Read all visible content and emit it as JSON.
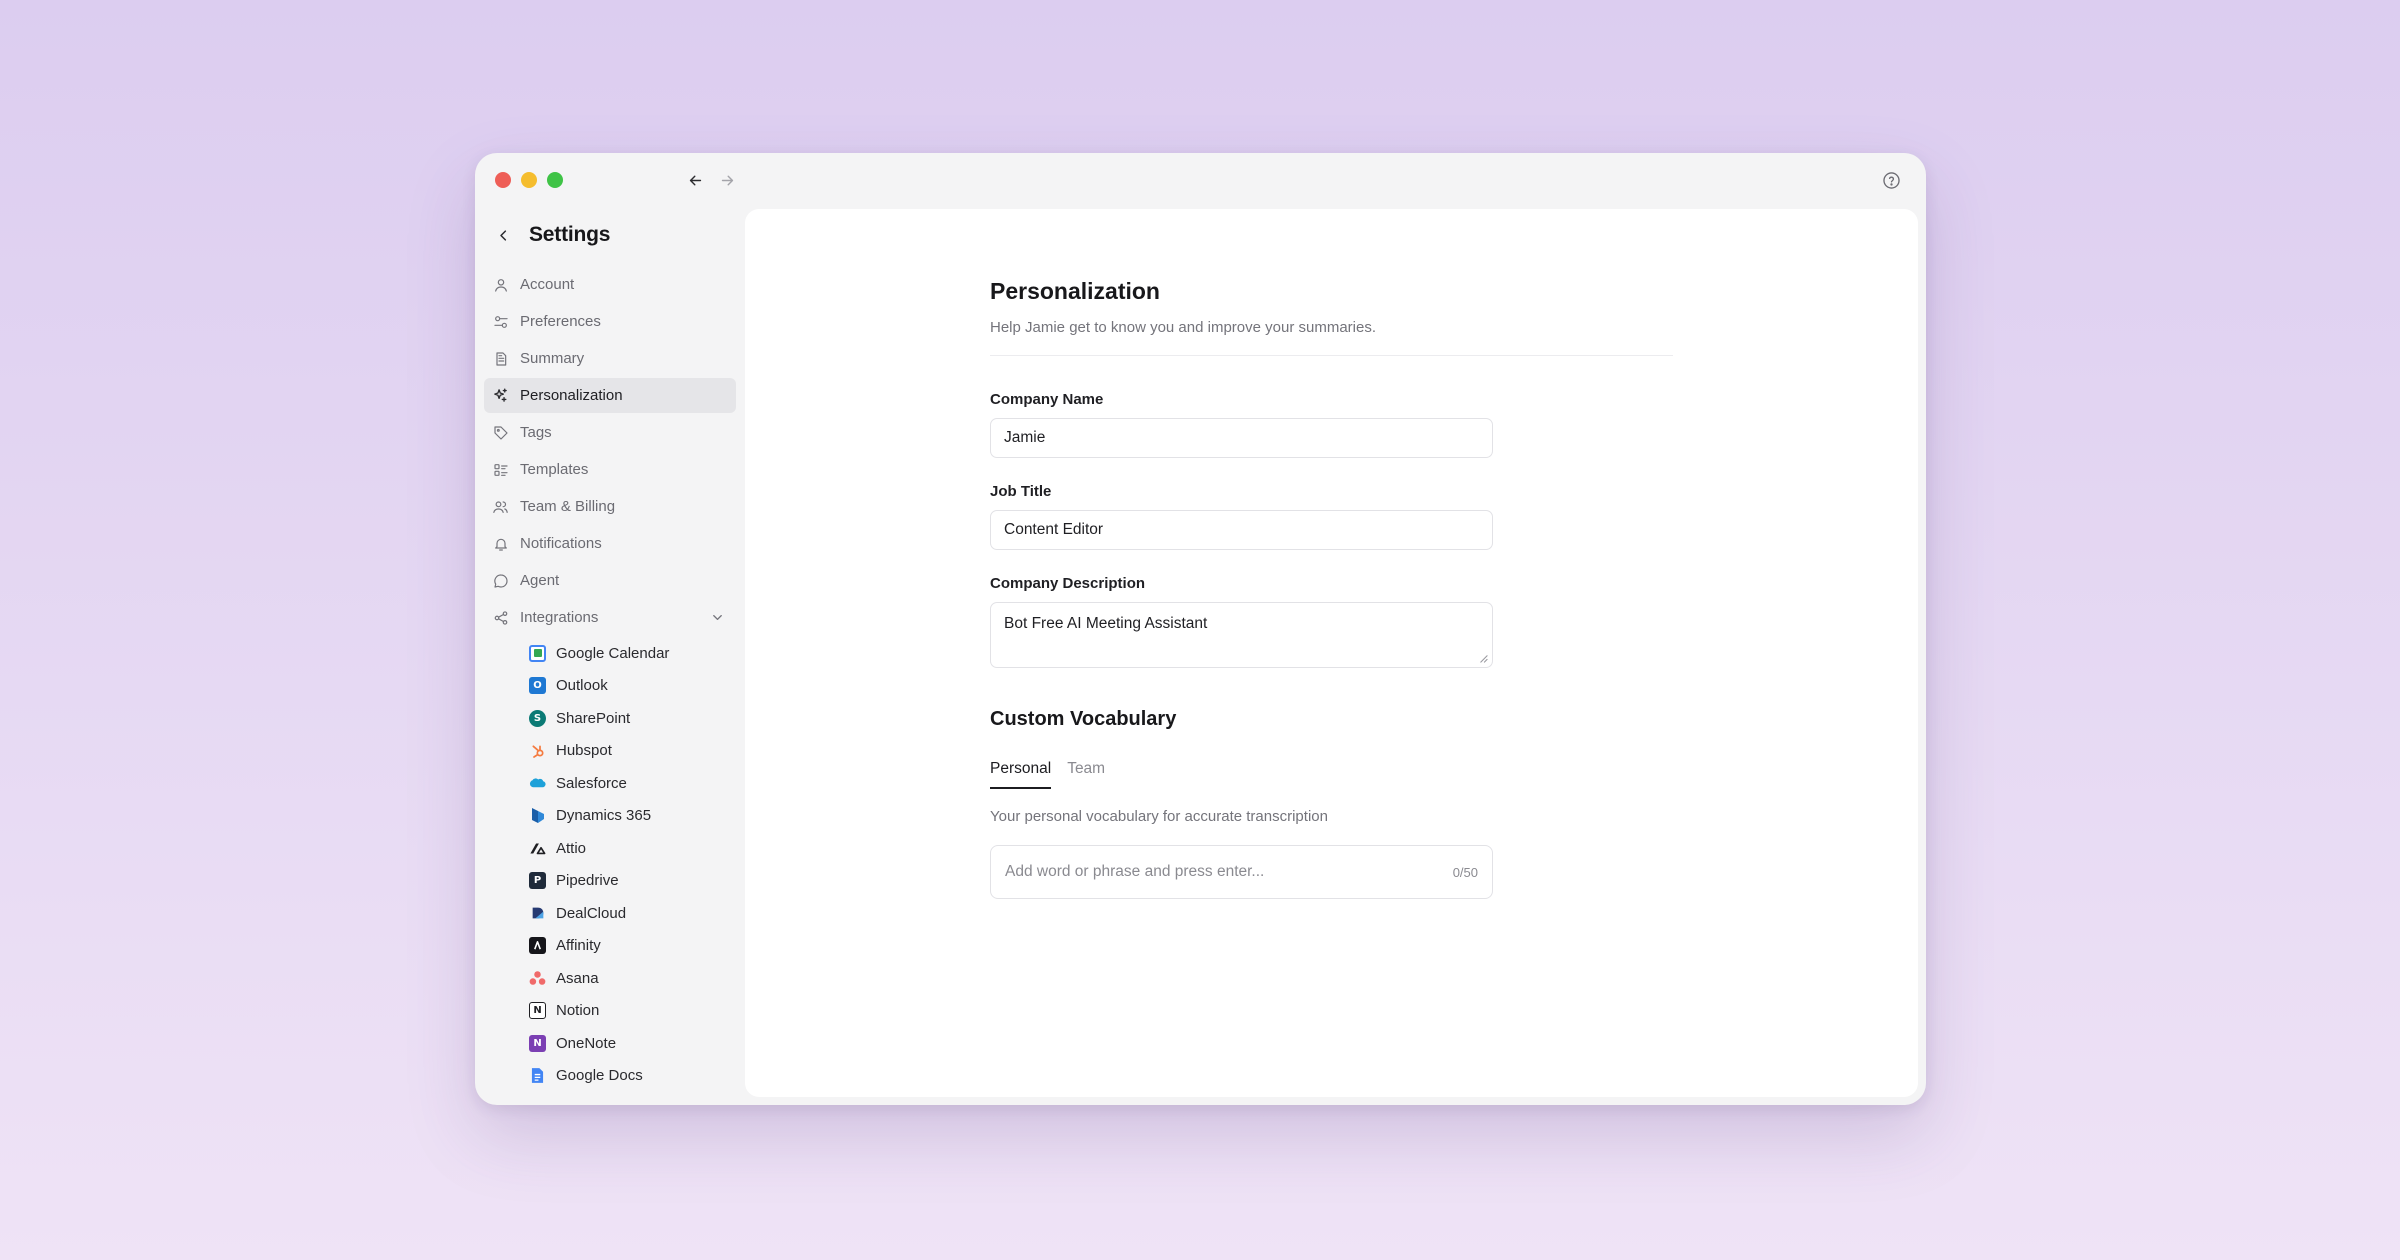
{
  "settings": {
    "title": "Settings"
  },
  "nav": {
    "items": [
      {
        "label": "Account",
        "icon": "user-icon"
      },
      {
        "label": "Preferences",
        "icon": "sliders-icon"
      },
      {
        "label": "Summary",
        "icon": "document-icon"
      },
      {
        "label": "Personalization",
        "icon": "sparkles-icon",
        "active": true
      },
      {
        "label": "Tags",
        "icon": "tag-icon"
      },
      {
        "label": "Templates",
        "icon": "list-icon"
      },
      {
        "label": "Team & Billing",
        "icon": "users-icon"
      },
      {
        "label": "Notifications",
        "icon": "bell-icon"
      },
      {
        "label": "Agent",
        "icon": "chat-bubble-icon"
      },
      {
        "label": "Integrations",
        "icon": "share-icon",
        "expanded": true
      }
    ],
    "integrations": [
      {
        "label": "Google Calendar",
        "icon": "google-calendar-icon"
      },
      {
        "label": "Outlook",
        "icon": "outlook-icon"
      },
      {
        "label": "SharePoint",
        "icon": "sharepoint-icon"
      },
      {
        "label": "Hubspot",
        "icon": "hubspot-icon"
      },
      {
        "label": "Salesforce",
        "icon": "salesforce-icon"
      },
      {
        "label": "Dynamics 365",
        "icon": "dynamics-icon"
      },
      {
        "label": "Attio",
        "icon": "attio-icon"
      },
      {
        "label": "Pipedrive",
        "icon": "pipedrive-icon"
      },
      {
        "label": "DealCloud",
        "icon": "dealcloud-icon"
      },
      {
        "label": "Affinity",
        "icon": "affinity-icon"
      },
      {
        "label": "Asana",
        "icon": "asana-icon"
      },
      {
        "label": "Notion",
        "icon": "notion-icon"
      },
      {
        "label": "OneNote",
        "icon": "onenote-icon"
      },
      {
        "label": "Google Docs",
        "icon": "google-docs-icon"
      }
    ]
  },
  "main": {
    "title": "Personalization",
    "subtitle": "Help Jamie get to know you and improve your summaries.",
    "fields": {
      "company_name": {
        "label": "Company Name",
        "value": "Jamie"
      },
      "job_title": {
        "label": "Job Title",
        "value": "Content Editor"
      },
      "company_description": {
        "label": "Company Description",
        "value": "Bot Free AI Meeting Assistant"
      }
    },
    "vocab": {
      "title": "Custom Vocabulary",
      "tabs": [
        "Personal",
        "Team"
      ],
      "active_tab": "Personal",
      "description": "Your personal vocabulary for accurate transcription",
      "placeholder": "Add word or phrase and press enter...",
      "count": "0/50"
    }
  },
  "colors": {
    "background": "#dccdf0",
    "active_nav": "#e5e5e8",
    "traffic_red": "#ee5e57",
    "traffic_yellow": "#f5bd2e",
    "traffic_green": "#3fc346"
  }
}
